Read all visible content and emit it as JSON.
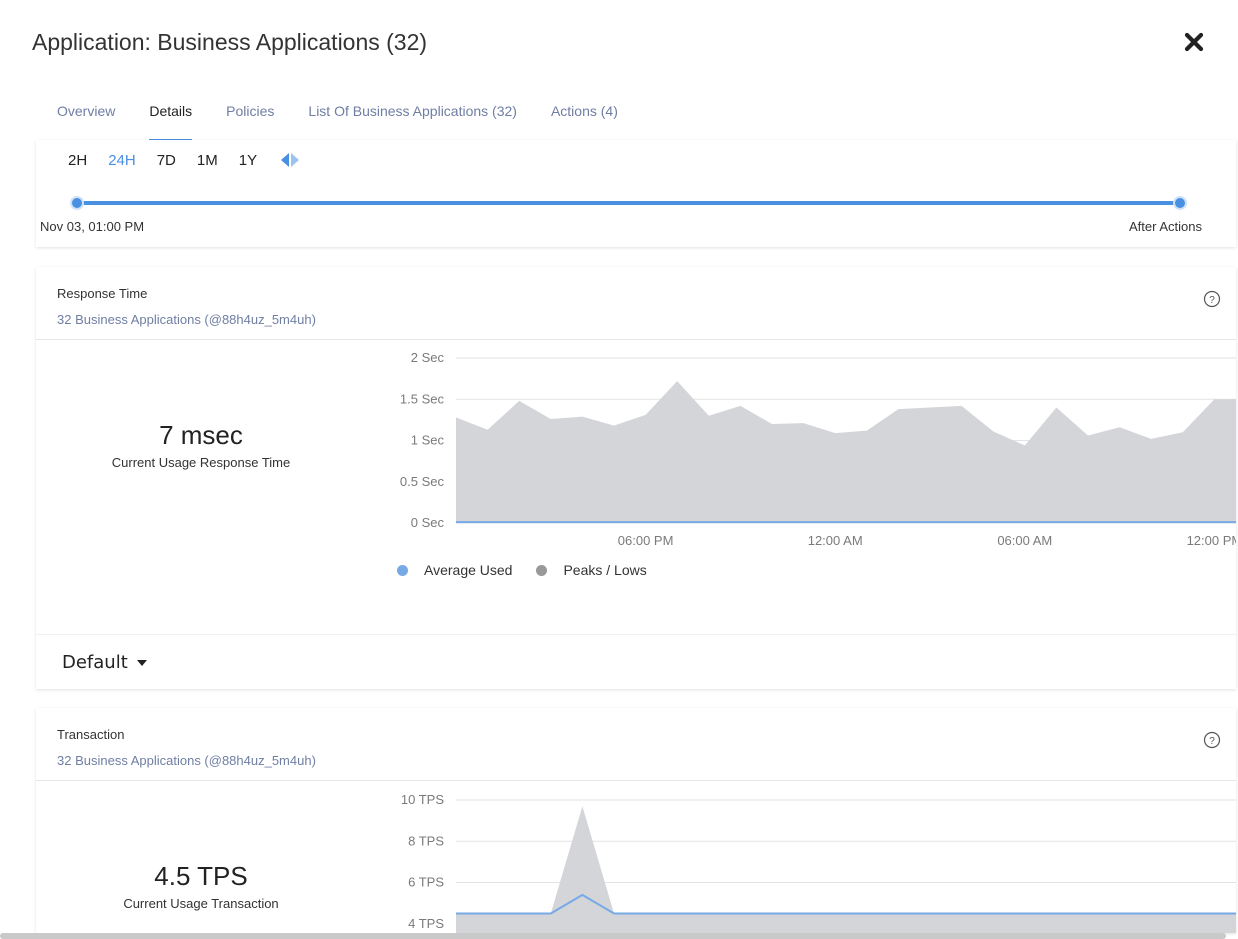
{
  "header": {
    "title": "Application: Business Applications (32)",
    "close_icon": "close-icon"
  },
  "tabs": [
    {
      "label": "Overview",
      "active": false
    },
    {
      "label": "Details",
      "active": true
    },
    {
      "label": "Policies",
      "active": false
    },
    {
      "label": "List Of Business Applications (32)",
      "active": false
    },
    {
      "label": "Actions (4)",
      "active": false
    }
  ],
  "time_range": {
    "options": [
      "2H",
      "24H",
      "7D",
      "1M",
      "1Y"
    ],
    "selected": "24H",
    "start_label": "Nov 03, 01:00 PM",
    "end_label": "After Actions",
    "nav_icon": "prev-next-arrows-icon"
  },
  "colors": {
    "accent": "#4a90e2",
    "area": "#d3d5d9",
    "avg": "#77a9e6",
    "peaks": "#999999"
  },
  "response_card": {
    "title": "Response Time",
    "subtitle": "32 Business Applications (@88h4uz_5m4uh)",
    "value": "7 msec",
    "caption": "Current Usage Response Time",
    "dropdown_value": "Default",
    "legend": [
      "Average Used",
      "Peaks / Lows"
    ]
  },
  "transaction_card": {
    "title": "Transaction",
    "subtitle": "32 Business Applications (@88h4uz_5m4uh)",
    "value": "4.5 TPS",
    "caption": "Current Usage Transaction"
  },
  "chart_data": [
    {
      "type": "area",
      "title": "Response Time",
      "y_ticks": [
        "0 Sec",
        "0.5 Sec",
        "1 Sec",
        "1.5 Sec",
        "2 Sec"
      ],
      "ylim": [
        0,
        2
      ],
      "x_ticks": [
        "06:00 PM",
        "12:00 AM",
        "06:00 AM",
        "12:00 PM"
      ],
      "x_tick_index": [
        6,
        12,
        18,
        24
      ],
      "series": [
        {
          "name": "Peaks / Lows",
          "values": [
            1.28,
            1.13,
            1.48,
            1.26,
            1.29,
            1.18,
            1.31,
            1.72,
            1.3,
            1.42,
            1.2,
            1.21,
            1.09,
            1.12,
            1.38,
            1.4,
            1.42,
            1.11,
            0.94,
            1.4,
            1.06,
            1.16,
            1.02,
            1.1,
            1.5,
            1.5
          ]
        },
        {
          "name": "Average Used",
          "values": [
            0.01,
            0.01,
            0.01,
            0.01,
            0.01,
            0.01,
            0.01,
            0.01,
            0.01,
            0.01,
            0.01,
            0.01,
            0.01,
            0.01,
            0.01,
            0.01,
            0.01,
            0.01,
            0.01,
            0.01,
            0.01,
            0.01,
            0.01,
            0.01,
            0.01,
            0.01
          ]
        }
      ],
      "grid": true,
      "legend": "bottom"
    },
    {
      "type": "area",
      "title": "Transaction",
      "y_ticks": [
        "4 TPS",
        "6 TPS",
        "8 TPS",
        "10 TPS"
      ],
      "ylim": [
        2,
        10
      ],
      "series": [
        {
          "name": "Peaks / Lows",
          "values": [
            4.5,
            4.5,
            4.5,
            4.5,
            9.7,
            4.5,
            4.5,
            4.5,
            4.5,
            4.5,
            4.5,
            4.5,
            4.5,
            4.5,
            4.5,
            4.5,
            4.5,
            4.5,
            4.5,
            4.5,
            4.5,
            4.5,
            4.5,
            4.5,
            4.5,
            4.5
          ]
        },
        {
          "name": "Average Used",
          "values": [
            4.5,
            4.5,
            4.5,
            4.5,
            5.4,
            4.5,
            4.5,
            4.5,
            4.5,
            4.5,
            4.5,
            4.5,
            4.5,
            4.5,
            4.5,
            4.5,
            4.5,
            4.5,
            4.5,
            4.5,
            4.5,
            4.5,
            4.5,
            4.5,
            4.5,
            4.5
          ]
        }
      ],
      "grid": true
    }
  ]
}
